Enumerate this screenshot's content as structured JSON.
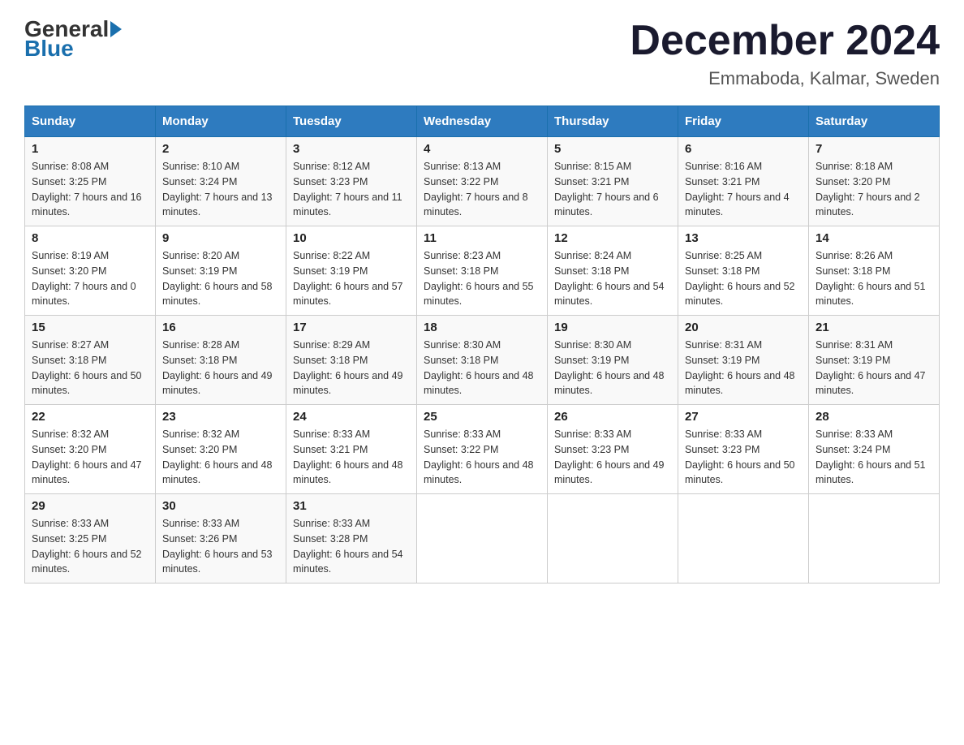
{
  "header": {
    "logo_general": "General",
    "logo_blue": "Blue",
    "month_year": "December 2024",
    "location": "Emmaboda, Kalmar, Sweden"
  },
  "weekdays": [
    "Sunday",
    "Monday",
    "Tuesday",
    "Wednesday",
    "Thursday",
    "Friday",
    "Saturday"
  ],
  "weeks": [
    [
      {
        "day": "1",
        "sunrise": "8:08 AM",
        "sunset": "3:25 PM",
        "daylight": "7 hours and 16 minutes."
      },
      {
        "day": "2",
        "sunrise": "8:10 AM",
        "sunset": "3:24 PM",
        "daylight": "7 hours and 13 minutes."
      },
      {
        "day": "3",
        "sunrise": "8:12 AM",
        "sunset": "3:23 PM",
        "daylight": "7 hours and 11 minutes."
      },
      {
        "day": "4",
        "sunrise": "8:13 AM",
        "sunset": "3:22 PM",
        "daylight": "7 hours and 8 minutes."
      },
      {
        "day": "5",
        "sunrise": "8:15 AM",
        "sunset": "3:21 PM",
        "daylight": "7 hours and 6 minutes."
      },
      {
        "day": "6",
        "sunrise": "8:16 AM",
        "sunset": "3:21 PM",
        "daylight": "7 hours and 4 minutes."
      },
      {
        "day": "7",
        "sunrise": "8:18 AM",
        "sunset": "3:20 PM",
        "daylight": "7 hours and 2 minutes."
      }
    ],
    [
      {
        "day": "8",
        "sunrise": "8:19 AM",
        "sunset": "3:20 PM",
        "daylight": "7 hours and 0 minutes."
      },
      {
        "day": "9",
        "sunrise": "8:20 AM",
        "sunset": "3:19 PM",
        "daylight": "6 hours and 58 minutes."
      },
      {
        "day": "10",
        "sunrise": "8:22 AM",
        "sunset": "3:19 PM",
        "daylight": "6 hours and 57 minutes."
      },
      {
        "day": "11",
        "sunrise": "8:23 AM",
        "sunset": "3:18 PM",
        "daylight": "6 hours and 55 minutes."
      },
      {
        "day": "12",
        "sunrise": "8:24 AM",
        "sunset": "3:18 PM",
        "daylight": "6 hours and 54 minutes."
      },
      {
        "day": "13",
        "sunrise": "8:25 AM",
        "sunset": "3:18 PM",
        "daylight": "6 hours and 52 minutes."
      },
      {
        "day": "14",
        "sunrise": "8:26 AM",
        "sunset": "3:18 PM",
        "daylight": "6 hours and 51 minutes."
      }
    ],
    [
      {
        "day": "15",
        "sunrise": "8:27 AM",
        "sunset": "3:18 PM",
        "daylight": "6 hours and 50 minutes."
      },
      {
        "day": "16",
        "sunrise": "8:28 AM",
        "sunset": "3:18 PM",
        "daylight": "6 hours and 49 minutes."
      },
      {
        "day": "17",
        "sunrise": "8:29 AM",
        "sunset": "3:18 PM",
        "daylight": "6 hours and 49 minutes."
      },
      {
        "day": "18",
        "sunrise": "8:30 AM",
        "sunset": "3:18 PM",
        "daylight": "6 hours and 48 minutes."
      },
      {
        "day": "19",
        "sunrise": "8:30 AM",
        "sunset": "3:19 PM",
        "daylight": "6 hours and 48 minutes."
      },
      {
        "day": "20",
        "sunrise": "8:31 AM",
        "sunset": "3:19 PM",
        "daylight": "6 hours and 48 minutes."
      },
      {
        "day": "21",
        "sunrise": "8:31 AM",
        "sunset": "3:19 PM",
        "daylight": "6 hours and 47 minutes."
      }
    ],
    [
      {
        "day": "22",
        "sunrise": "8:32 AM",
        "sunset": "3:20 PM",
        "daylight": "6 hours and 47 minutes."
      },
      {
        "day": "23",
        "sunrise": "8:32 AM",
        "sunset": "3:20 PM",
        "daylight": "6 hours and 48 minutes."
      },
      {
        "day": "24",
        "sunrise": "8:33 AM",
        "sunset": "3:21 PM",
        "daylight": "6 hours and 48 minutes."
      },
      {
        "day": "25",
        "sunrise": "8:33 AM",
        "sunset": "3:22 PM",
        "daylight": "6 hours and 48 minutes."
      },
      {
        "day": "26",
        "sunrise": "8:33 AM",
        "sunset": "3:23 PM",
        "daylight": "6 hours and 49 minutes."
      },
      {
        "day": "27",
        "sunrise": "8:33 AM",
        "sunset": "3:23 PM",
        "daylight": "6 hours and 50 minutes."
      },
      {
        "day": "28",
        "sunrise": "8:33 AM",
        "sunset": "3:24 PM",
        "daylight": "6 hours and 51 minutes."
      }
    ],
    [
      {
        "day": "29",
        "sunrise": "8:33 AM",
        "sunset": "3:25 PM",
        "daylight": "6 hours and 52 minutes."
      },
      {
        "day": "30",
        "sunrise": "8:33 AM",
        "sunset": "3:26 PM",
        "daylight": "6 hours and 53 minutes."
      },
      {
        "day": "31",
        "sunrise": "8:33 AM",
        "sunset": "3:28 PM",
        "daylight": "6 hours and 54 minutes."
      },
      null,
      null,
      null,
      null
    ]
  ],
  "labels": {
    "sunrise": "Sunrise:",
    "sunset": "Sunset:",
    "daylight": "Daylight:"
  }
}
